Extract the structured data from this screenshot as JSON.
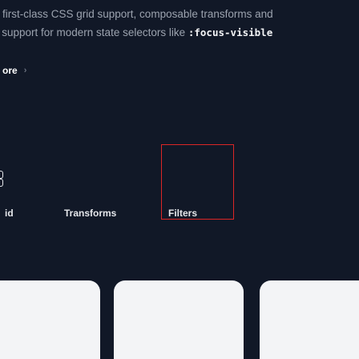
{
  "intro": {
    "line1": "ot first-class CSS grid support, composable transforms and",
    "line2_text": "s, support for modern state selectors like ",
    "line2_code": ":focus-visible"
  },
  "explore": {
    "label": "ore",
    "chevron": "›"
  },
  "features": {
    "grid_label": "id",
    "transforms_label": "Transforms",
    "filters_label": "Filters"
  },
  "colors": {
    "background": "#111827",
    "highlight_border": "#dc2626",
    "card": "#f3f4f6"
  }
}
